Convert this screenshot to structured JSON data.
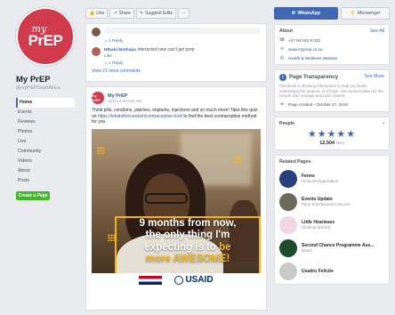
{
  "page": {
    "avatar_line1": "my",
    "avatar_line2": "PrEP",
    "name": "My PrEP",
    "handle": "@myPrEPSouthAfrica"
  },
  "left_nav": {
    "items": [
      "Home",
      "Events",
      "Reviews",
      "Photos",
      "Live",
      "Community",
      "Videos",
      "About",
      "Posts"
    ],
    "create_page": "Create a Page"
  },
  "action_bar": {
    "like": "Like",
    "share": "Share",
    "suggest": "Suggest Edits",
    "more": "···"
  },
  "comments": {
    "reply1": "1 Reply",
    "commenter_name": "Nthabi Mothapo",
    "commenter_text": "interacted new can't get prep",
    "like": "Like",
    "reply2": "1 Reply",
    "view_more": "View 21 more comments"
  },
  "post": {
    "avatar": "my PrEP",
    "author": "My PrEP",
    "time": "April 13 at 6:00 AM",
    "text": "Think pills, condoms, patches, implants, injections and so much more! Take this quiz on",
    "link": "https://whatsthecondom/contraceptive-tool/",
    "text_end": "to find the best contraceptive method for you",
    "image_line1": "9 months from now,",
    "image_line2": "the only thing I'm",
    "image_line3_a": "expecting is to ",
    "image_line3_b": "be",
    "image_line4": "more AWESOME!",
    "sponsor": "USAID"
  },
  "sidebar": {
    "whatsapp_label": "WhatsApp",
    "messenger_label": "Messenger",
    "about_title": "About",
    "see_all": "See All",
    "phone": "+27 84 182 9 033",
    "website": "www.myprep.co.za",
    "category": "Health & Wellness Website",
    "transparency_title": "Page Transparency",
    "see_more": "See More",
    "transparency_text": "Facebook is showing information to help you better understand the purpose of a Page. See actions taken by the people who manage and post content.",
    "created": "Page created - October 17, 2018",
    "people_title": "People",
    "rating_value": "12,504",
    "rating_suffix": "likes",
    "related_title": "Related Pages",
    "related": [
      {
        "name": "Fenns",
        "category": "Product/Organization"
      },
      {
        "name": "Events Update",
        "category": "Party Entertainment Service"
      },
      {
        "name": "Little Heartease",
        "category": "Clothing (Brand)"
      },
      {
        "name": "Second Chance Programme Aus...",
        "category": "Brand"
      },
      {
        "name": "Usadru Felicite",
        "category": ""
      }
    ]
  },
  "colors": {
    "brand_blue": "#4267b2",
    "prep_red": "#d03a4a",
    "accent_yellow": "#f4b728",
    "create_green": "#42b72a"
  }
}
